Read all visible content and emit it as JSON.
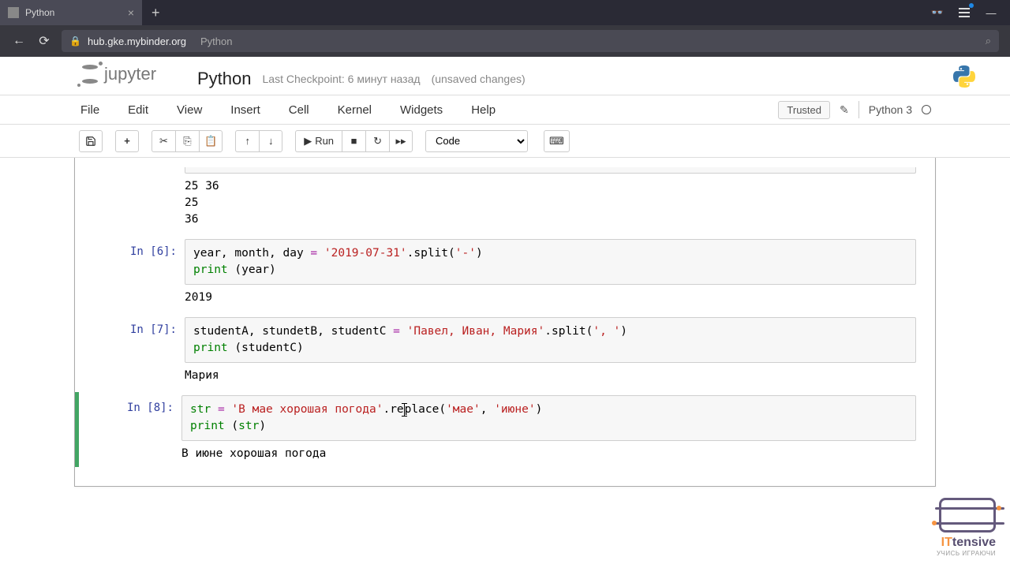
{
  "browser": {
    "tab_title": "Python",
    "url_domain": "hub.gke.mybinder.org",
    "url_path": "Python"
  },
  "header": {
    "logo_text": "jupyter",
    "title": "Python",
    "checkpoint": "Last Checkpoint: 6 минут назад",
    "unsaved": "(unsaved changes)"
  },
  "menu": {
    "items": [
      "File",
      "Edit",
      "View",
      "Insert",
      "Cell",
      "Kernel",
      "Widgets",
      "Help"
    ],
    "trusted": "Trusted",
    "kernel": "Python 3"
  },
  "toolbar": {
    "run_label": "Run",
    "cell_type": "Code"
  },
  "cells": [
    {
      "prompt": "",
      "output": "25 36\n25\n36"
    },
    {
      "prompt": "In [6]:",
      "code_raw": "year, month, day = '2019-07-31'.split('-')\nprint (year)",
      "tokens": [
        [
          {
            "t": "year, month, day ",
            "c": "nm"
          },
          {
            "t": "=",
            "c": "op"
          },
          {
            "t": " ",
            "c": "nm"
          },
          {
            "t": "'2019-07-31'",
            "c": "st"
          },
          {
            "t": ".split(",
            "c": "nm"
          },
          {
            "t": "'-'",
            "c": "st"
          },
          {
            "t": ")",
            "c": "nm"
          }
        ],
        [
          {
            "t": "print",
            "c": "bn"
          },
          {
            "t": " (year)",
            "c": "nm"
          }
        ]
      ],
      "output": "2019"
    },
    {
      "prompt": "In [7]:",
      "code_raw": "studentA, stundetB, studentC = 'Павел, Иван, Мария'.split(', ')\nprint (studentC)",
      "tokens": [
        [
          {
            "t": "studentA, stundetB, studentC ",
            "c": "nm"
          },
          {
            "t": "=",
            "c": "op"
          },
          {
            "t": " ",
            "c": "nm"
          },
          {
            "t": "'Павел, Иван, Мария'",
            "c": "st"
          },
          {
            "t": ".split(",
            "c": "nm"
          },
          {
            "t": "', '",
            "c": "st"
          },
          {
            "t": ")",
            "c": "nm"
          }
        ],
        [
          {
            "t": "print",
            "c": "bn"
          },
          {
            "t": " (studentC)",
            "c": "nm"
          }
        ]
      ],
      "output": "Мария"
    },
    {
      "prompt": "In [8]:",
      "selected": true,
      "code_raw": "str = 'В мае хорошая погода'.replace('мае', 'июне')\nprint (str)",
      "tokens": [
        [
          {
            "t": "str",
            "c": "bn"
          },
          {
            "t": " ",
            "c": "nm"
          },
          {
            "t": "=",
            "c": "op"
          },
          {
            "t": " ",
            "c": "nm"
          },
          {
            "t": "'В мае хорошая погода'",
            "c": "st"
          },
          {
            "t": ".re",
            "c": "nm"
          },
          {
            "cursor": true
          },
          {
            "t": "place(",
            "c": "nm"
          },
          {
            "t": "'мае'",
            "c": "st"
          },
          {
            "t": ", ",
            "c": "nm"
          },
          {
            "t": "'июне'",
            "c": "st"
          },
          {
            "t": ")",
            "c": "nm"
          }
        ],
        [
          {
            "t": "print",
            "c": "bn"
          },
          {
            "t": " (",
            "c": "nm"
          },
          {
            "t": "str",
            "c": "bn"
          },
          {
            "t": ")",
            "c": "nm"
          }
        ]
      ],
      "output": "В июне хорошая погода"
    }
  ],
  "watermark": {
    "brand1": "IT",
    "brand2": "tensive",
    "sub": "УЧИСЬ ИГРАЮЧИ"
  }
}
